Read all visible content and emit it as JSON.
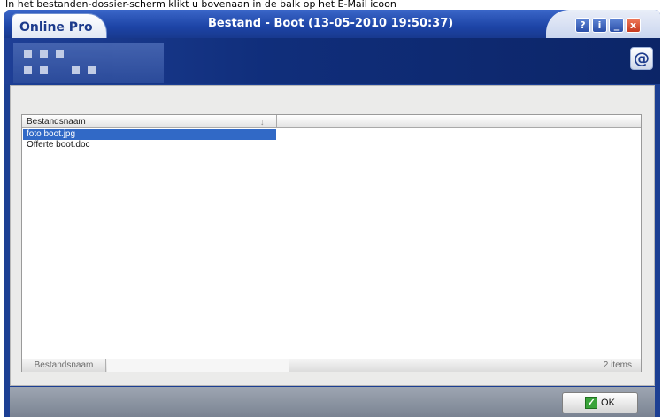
{
  "caption": "In het bestanden-dossier-scherm klikt u bovenaan in de balk op het E-Mail icoon",
  "window": {
    "app_name": "Online Pro",
    "title": "Bestand - Boot (13-05-2010 19:50:37)",
    "controls": {
      "help": "?",
      "info": "i",
      "minimize": "_",
      "close": "x"
    }
  },
  "header": {
    "email_icon": "@"
  },
  "file_list": {
    "column_header": "Bestandsnaam",
    "sort_indicator": "↓",
    "rows": [
      {
        "name": "foto boot.jpg",
        "selected": true
      },
      {
        "name": "Offerte boot.doc",
        "selected": false
      }
    ],
    "footer_label": "Bestandsnaam",
    "footer_filter_value": "",
    "item_count": "2 items"
  },
  "buttons": {
    "ok_label": "OK"
  },
  "colors": {
    "window_blue": "#1c3f93",
    "selection": "#3169c6",
    "close_red": "#c63a1f",
    "ok_check_green": "#3aa33a"
  },
  "icons": {
    "help": "help-icon",
    "info": "info-icon",
    "minimize": "minimize-icon",
    "close": "close-icon",
    "email": "email-icon",
    "ok": "check-icon",
    "sort": "sort-arrow-icon"
  }
}
